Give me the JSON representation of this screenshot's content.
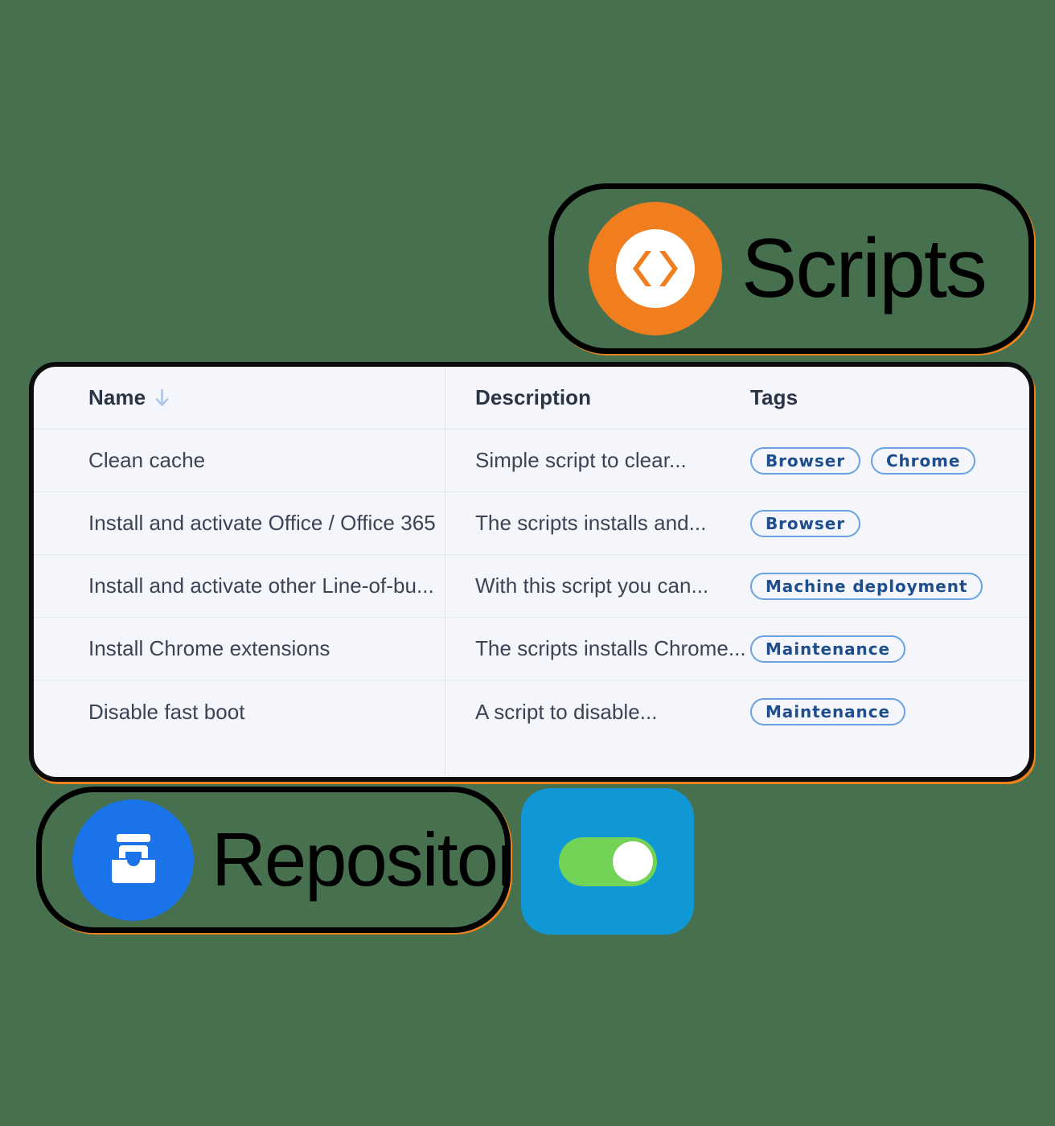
{
  "background_color": "#47704e",
  "badges": {
    "scripts": {
      "label": "Scripts",
      "icon": "code-brackets-icon",
      "accent_color": "#f07e1f"
    },
    "repository": {
      "label": "Repository",
      "icon": "archive-inbox-icon",
      "accent_color": "#1a73e8"
    }
  },
  "toggle_tile": {
    "icon": "toggle-switch-on-icon",
    "state": "on",
    "tile_color": "#0f97d6",
    "track_color": "#72d357",
    "knob_color": "#ffffff"
  },
  "table": {
    "sort": {
      "column": "Name",
      "direction": "descending",
      "icon": "arrow-down-icon"
    },
    "columns": [
      "Name",
      "Description",
      "Tags"
    ],
    "rows": [
      {
        "name": "Clean cache",
        "description": "Simple script to clear...",
        "tags": [
          "Browser",
          "Chrome"
        ]
      },
      {
        "name": "Install and activate Office / Office 365",
        "description": "The scripts installs and...",
        "tags": [
          "Browser"
        ]
      },
      {
        "name": "Install and activate other Line-of-bu...",
        "description": "With this script you can...",
        "tags": [
          "Machine deployment"
        ]
      },
      {
        "name": "Install Chrome extensions",
        "description": "The scripts installs Chrome...",
        "tags": [
          "Maintenance"
        ]
      },
      {
        "name": "Disable fast boot",
        "description": "A script to disable...",
        "tags": [
          "Maintenance"
        ]
      }
    ]
  }
}
